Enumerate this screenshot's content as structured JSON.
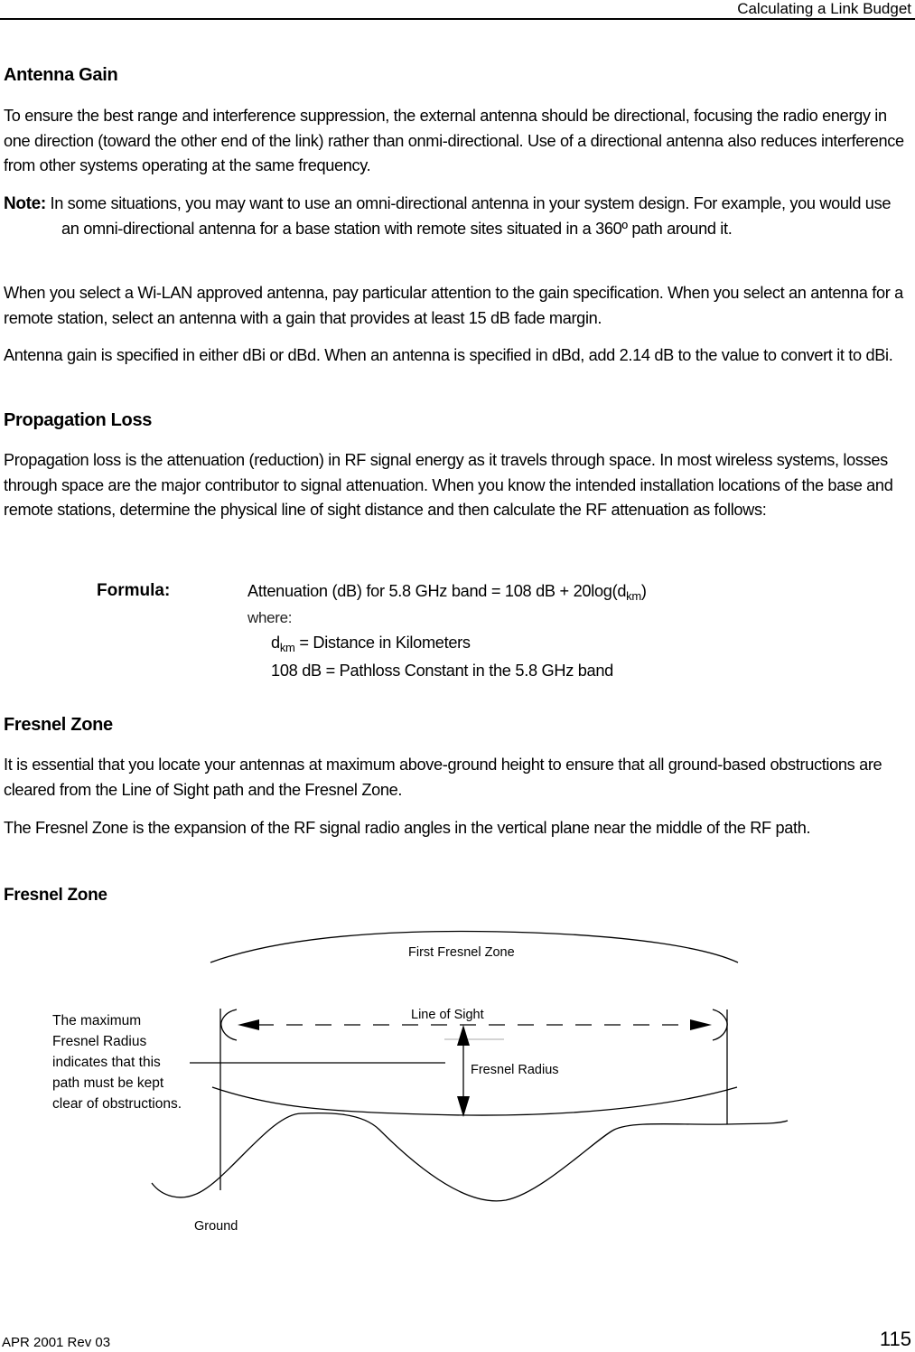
{
  "header": {
    "title": "Calculating a Link Budget"
  },
  "sections": {
    "antenna_gain": {
      "heading": "Antenna Gain",
      "para1": "To ensure the best range and interference suppression, the external antenna should be directional, focusing the radio energy in one direction (toward the other end of the link) rather than onmi-directional. Use of a directional antenna also reduces interference from other systems operating at the same frequency.",
      "note_label": "Note:",
      "note_text": "In some situations, you may want to use an omni-directional antenna in your system design. For example, you would use an omni-directional antenna for a base station with remote sites situated in a 360º path around it.",
      "para2": "When you select a Wi-LAN approved antenna, pay particular attention to the gain specification. When you select an antenna for a remote station, select an antenna with a gain that provides at least 15 dB fade margin.",
      "para3": "Antenna gain is specified in either dBi or dBd. When an antenna is specified in dBd, add 2.14 dB to the value to convert it to dBi."
    },
    "propagation_loss": {
      "heading": "Propagation Loss",
      "para1": "Propagation loss is the attenuation (reduction) in RF signal energy as it travels through space. In most wireless systems, losses through space are the major contributor to signal attenuation. When you know the intended installation locations of the base and remote stations, determine the physical line of sight distance and then calculate the RF attenuation as follows:"
    },
    "formula": {
      "label": "Formula:",
      "line1_prefix": "Attenuation (dB) for 5.8 GHz band = 108 dB + 20log(d",
      "line1_sub": "km",
      "line1_suffix": ")",
      "where": "where:",
      "def1_var": "d",
      "def1_sub": "km",
      "def1_text": " = Distance in Kilometers",
      "def2_text": "108 dB = Pathloss Constant in the 5.8 GHz band"
    },
    "fresnel_zone": {
      "heading": "Fresnel Zone",
      "para1": "It is essential that you locate your antennas at maximum above-ground height to ensure that all ground-based obstructions are cleared from the Line of Sight path and the Fresnel Zone.",
      "para2": "The Fresnel Zone is the expansion of the RF signal radio angles in the vertical plane near the middle of the RF path.",
      "figure_heading": "Fresnel Zone"
    }
  },
  "figure": {
    "first_fresnel_zone": "First Fresnel Zone",
    "line_of_sight": "Line of Sight",
    "fresnel_radius": "Fresnel Radius",
    "ground": "Ground",
    "side_note": "The maximum Fresnel Radius indicates that this path must be kept clear of obstructions."
  },
  "footer": {
    "revision": "APR 2001 Rev 03",
    "page_number": "115"
  }
}
